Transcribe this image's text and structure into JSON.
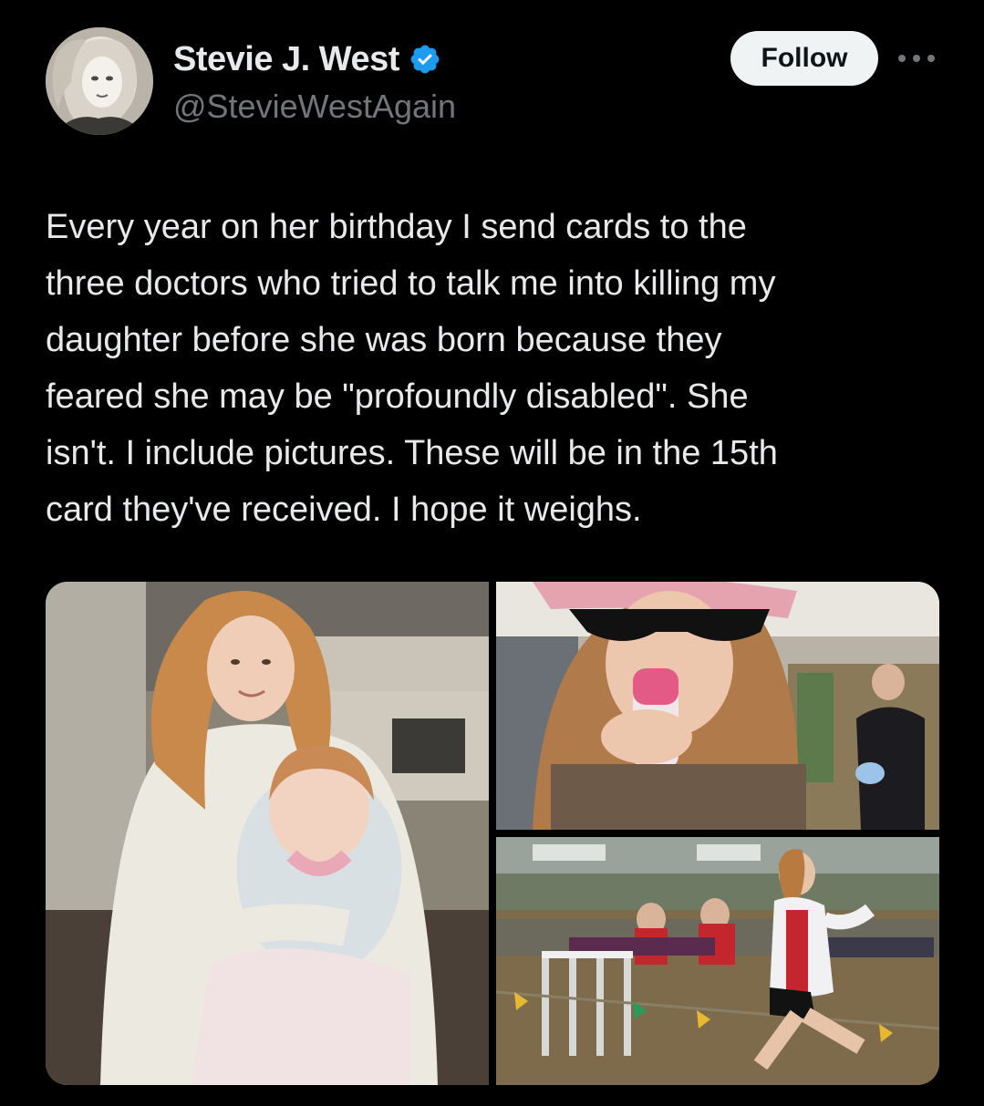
{
  "author": {
    "display_name": "Stevie J. West",
    "handle": "@StevieWestAgain",
    "verified": true,
    "avatar_icon": "profile-photo-avatar",
    "verified_badge_color": "#1d9bf0"
  },
  "actions": {
    "follow_label": "Follow",
    "more_icon": "more-horizontal-icon"
  },
  "tweet": {
    "text": "Every year on her birthday I send cards to the\nthree doctors who tried to talk me into killing my\ndaughter before she was born because they\nfeared she may be \"profoundly disabled\". She\nisn't. I include pictures. These will be in the 15th\ncard they've received. I hope it weighs."
  },
  "media": {
    "count": 3,
    "photos": [
      {
        "label": "photo-girl-holding-baby"
      },
      {
        "label": "photo-girl-sunglasses-drink"
      },
      {
        "label": "photo-girl-running-race"
      }
    ]
  },
  "colors": {
    "background": "#000000",
    "primary_text": "#e7e9ea",
    "secondary_text": "#71767b",
    "follow_button_bg": "#eff3f4",
    "follow_button_text": "#0f1419"
  }
}
